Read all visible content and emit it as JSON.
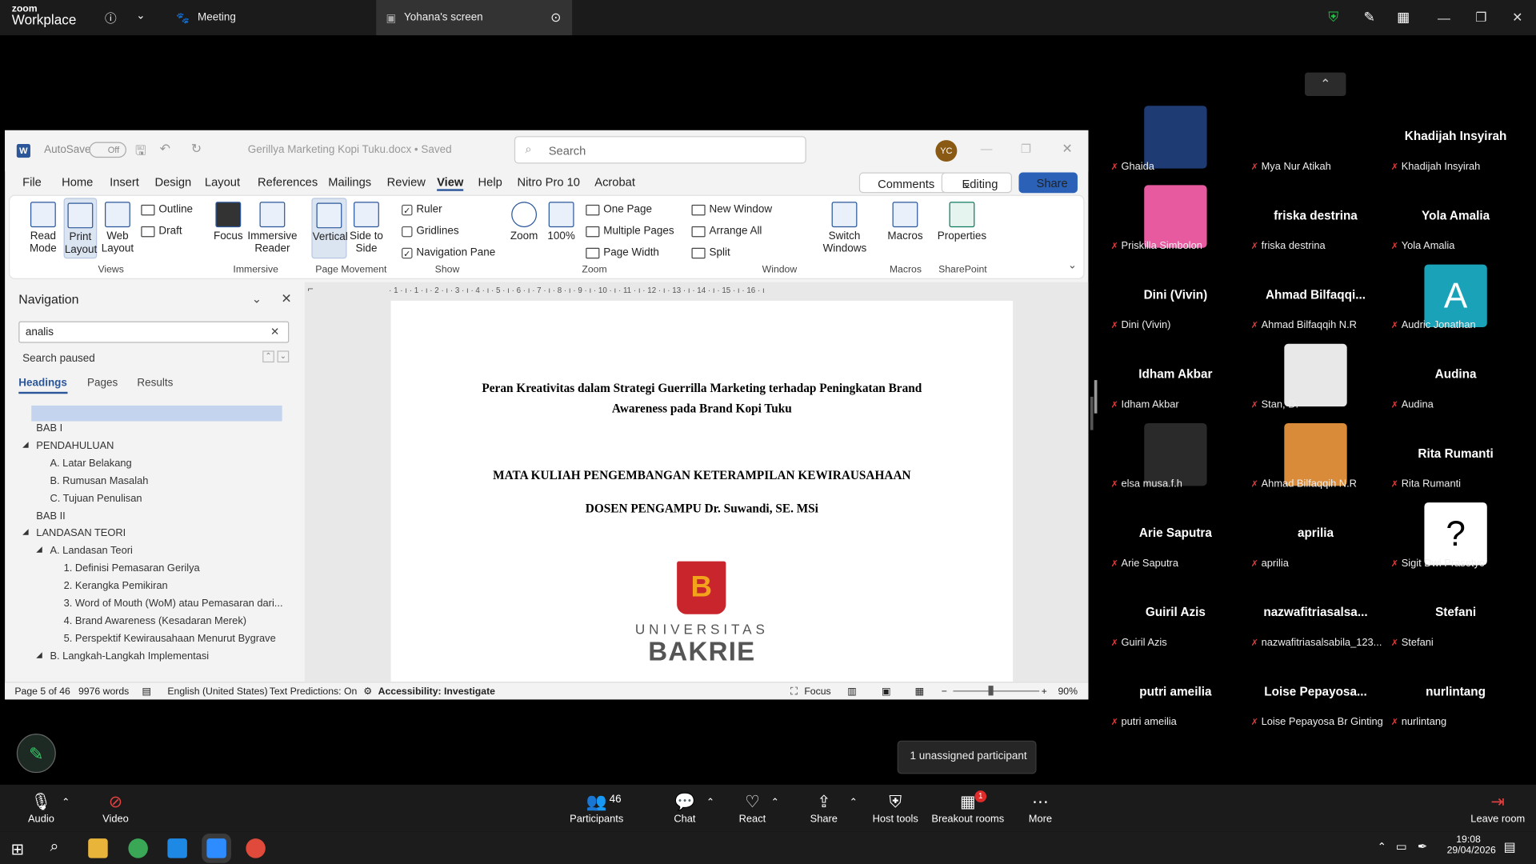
{
  "zoom": {
    "brand_top": "zoom",
    "brand": "Workplace",
    "meeting_label": "Meeting",
    "share_tab": "Yohana's screen"
  },
  "word": {
    "autosave": "AutoSave",
    "autosave_state": "Off",
    "doc_title": "Gerillya Marketing Kopi Tuku.docx • Saved",
    "search_placeholder": "Search",
    "user_initials": "YC",
    "menu": [
      "File",
      "Home",
      "Insert",
      "Design",
      "Layout",
      "References",
      "Mailings",
      "Review",
      "View",
      "Help",
      "Nitro Pro 10",
      "Acrobat"
    ],
    "active_menu": "View",
    "comments": "Comments",
    "editing": "Editing",
    "share": "Share",
    "ribbon": {
      "read_mode": "Read Mode",
      "print_layout": "Print Layout",
      "web_layout": "Web Layout",
      "outline": "Outline",
      "draft": "Draft",
      "views_group": "Views",
      "focus": "Focus",
      "immersive_reader": "Immersive Reader",
      "immersive_group": "Immersive",
      "vertical": "Vertical",
      "side_to_side": "Side to Side",
      "page_movement_group": "Page Movement",
      "ruler": "Ruler",
      "gridlines": "Gridlines",
      "navigation_pane": "Navigation Pane",
      "show_group": "Show",
      "zoom": "Zoom",
      "zoom_100": "100%",
      "one_page": "One Page",
      "multiple_pages": "Multiple Pages",
      "page_width": "Page Width",
      "zoom_group": "Zoom",
      "new_window": "New Window",
      "arrange_all": "Arrange All",
      "split": "Split",
      "switch_windows": "Switch Windows",
      "window_group": "Window",
      "macros": "Macros",
      "macros_group": "Macros",
      "properties": "Properties",
      "sharepoint_group": "SharePoint"
    },
    "nav": {
      "title": "Navigation",
      "search_value": "analis",
      "search_status": "Search paused",
      "tabs": [
        "Headings",
        "Pages",
        "Results"
      ],
      "items": [
        {
          "text": "BAB I",
          "indent": 0,
          "caret": false
        },
        {
          "text": "PENDAHULUAN",
          "indent": 0,
          "caret": true
        },
        {
          "text": "A. Latar Belakang",
          "indent": 1,
          "caret": false
        },
        {
          "text": "B. Rumusan Masalah",
          "indent": 1,
          "caret": false
        },
        {
          "text": "C. Tujuan Penulisan",
          "indent": 1,
          "caret": false
        },
        {
          "text": "BAB II",
          "indent": 0,
          "caret": false
        },
        {
          "text": "LANDASAN TEORI",
          "indent": 0,
          "caret": true
        },
        {
          "text": "A. Landasan Teori",
          "indent": 1,
          "caret": true
        },
        {
          "text": "1. Definisi Pemasaran Gerilya",
          "indent": 2,
          "caret": false
        },
        {
          "text": "2. Kerangka Pemikiran",
          "indent": 2,
          "caret": false
        },
        {
          "text": "3. Word of Mouth (WoM) atau Pemasaran dari...",
          "indent": 2,
          "caret": false
        },
        {
          "text": "4. Brand Awareness (Kesadaran Merek)",
          "indent": 2,
          "caret": false
        },
        {
          "text": "5. Perspektif Kewirausahaan Menurut Bygrave",
          "indent": 2,
          "caret": false
        },
        {
          "text": "B.  Langkah-Langkah Implementasi",
          "indent": 1,
          "caret": true
        }
      ]
    },
    "ruler_text": "· 1 · ı · 1 · ı · 2 · ı · 3 · ı · 4 · ı · 5 · ı · 6 · ı · 7 · ı · 8 · ı · 9 · ı · 10 · ı · 11 · ı · 12 · ı · 13 · ı · 14 · ı · 15 · ı · 16 · ı",
    "page": {
      "title_line1": "Peran Kreativitas dalam Strategi Guerrilla Marketing terhadap Peningkatan Brand",
      "title_line2": "Awareness pada Brand Kopi Tuku",
      "course": "MATA KULIAH PENGEMBANGAN KETERAMPILAN KEWIRAUSAHAAN",
      "lecturer": "DOSEN PENGAMPU Dr. Suwandi, SE. MSi",
      "logo_top": "UNIVERSITAS",
      "logo_bottom": "BAKRIE"
    },
    "status": {
      "page": "Page 5 of 46",
      "words": "9976 words",
      "language": "English (United States)",
      "predictions": "Text Predictions: On",
      "accessibility": "Accessibility: Investigate",
      "focus": "Focus",
      "zoom": "90%"
    }
  },
  "participants": [
    {
      "name": "",
      "label": "Ghaida",
      "tile": "#1f3b73",
      "col": 0,
      "row": 0
    },
    {
      "name": "",
      "label": "Mya Nur Atikah",
      "tile": "#000000",
      "col": 1,
      "row": 0
    },
    {
      "name": "Khadijah Insyirah",
      "label": "Khadijah Insyirah",
      "col": 2,
      "row": 0
    },
    {
      "name": "",
      "label": "Priskilla Simbolon",
      "tile": "#e85aa0",
      "col": 0,
      "row": 1
    },
    {
      "name": "friska destrina",
      "label": "friska destrina",
      "col": 1,
      "row": 1
    },
    {
      "name": "Yola Amalia",
      "label": "Yola Amalia",
      "col": 2,
      "row": 1
    },
    {
      "name": "Dini (Vivin)",
      "label": "Dini (Vivin)",
      "col": 0,
      "row": 2
    },
    {
      "name": "Ahmad  Bilfaqqi...",
      "label": "Ahmad Bilfaqqih N.R",
      "col": 1,
      "row": 2
    },
    {
      "name": "",
      "label": "Audric Jonathan",
      "tile": "#1aa3b8",
      "letter": "A",
      "col": 2,
      "row": 2
    },
    {
      "name": "Idham Akbar",
      "label": "Idham Akbar",
      "col": 0,
      "row": 3
    },
    {
      "name": "",
      "label": "Stan, D.",
      "tile": "#e8e8e8",
      "col": 1,
      "row": 3
    },
    {
      "name": "Audina",
      "label": "Audina",
      "col": 2,
      "row": 3
    },
    {
      "name": "",
      "label": "elsa musa.f.h",
      "tile": "#2a2a2a",
      "col": 0,
      "row": 4
    },
    {
      "name": "",
      "label": "Ahmad Bilfaqqih N.R",
      "tile": "#d98b3a",
      "col": 1,
      "row": 4
    },
    {
      "name": "Rita Rumanti",
      "label": "Rita Rumanti",
      "col": 2,
      "row": 4
    },
    {
      "name": "Arie Saputra",
      "label": "Arie Saputra",
      "col": 0,
      "row": 5
    },
    {
      "name": "aprilia",
      "label": "aprilia",
      "col": 1,
      "row": 5
    },
    {
      "name": "",
      "label": "Sigit Dwi Prasetyo",
      "tile": "#ffffff",
      "letter": "?",
      "col": 2,
      "row": 5
    },
    {
      "name": "Guiril Azis",
      "label": "Guiril Azis",
      "col": 0,
      "row": 6
    },
    {
      "name": "nazwafitriasalsa...",
      "label": "nazwafitriasalsabila_123...",
      "col": 1,
      "row": 6
    },
    {
      "name": "Stefani",
      "label": "Stefani",
      "col": 2,
      "row": 6
    },
    {
      "name": "putri ameilia",
      "label": "putri ameilia",
      "col": 0,
      "row": 7
    },
    {
      "name": "Loise  Pepayosa...",
      "label": "Loise Pepayosa Br Ginting",
      "col": 1,
      "row": 7
    },
    {
      "name": "nurlintang",
      "label": "nurlintang",
      "col": 2,
      "row": 7
    }
  ],
  "tooltip": "1 unassigned participant",
  "toolbar": {
    "audio": "Audio",
    "video": "Video",
    "participants": "Participants",
    "participants_count": "46",
    "chat": "Chat",
    "react": "React",
    "share": "Share",
    "host_tools": "Host tools",
    "breakout": "Breakout rooms",
    "breakout_badge": "1",
    "more": "More",
    "leave": "Leave room"
  },
  "clock": {
    "time": "19:08",
    "date": "29/04/2026"
  }
}
